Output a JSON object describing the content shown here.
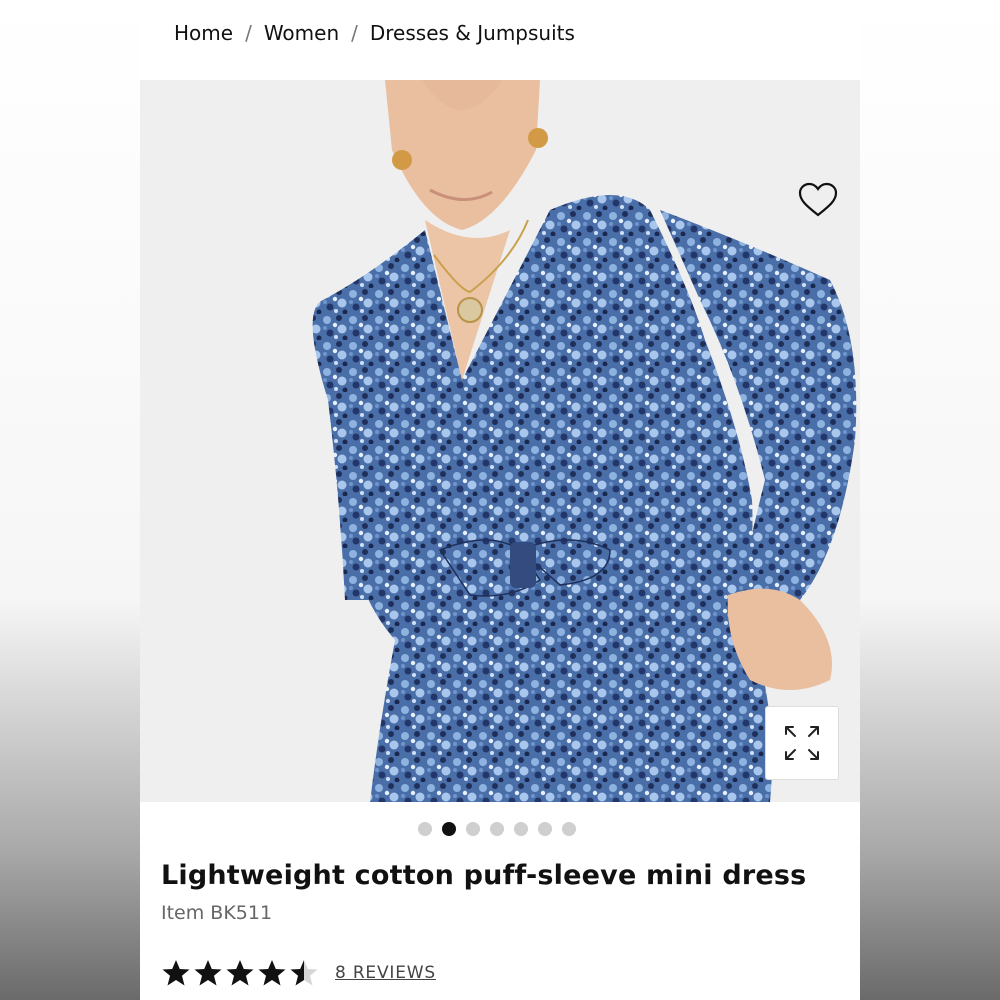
{
  "breadcrumb": {
    "items": [
      "Home",
      "Women",
      "Dresses & Jumpsuits"
    ],
    "separator": "/"
  },
  "product_image": {
    "wishlist_icon": "heart-outline-icon",
    "zoom_icon": "expand-arrows-icon",
    "dress_color": "#5b7fb5"
  },
  "carousel": {
    "total_slides": 7,
    "active_index": 1
  },
  "product": {
    "title": "Lightweight cotton puff-sleeve mini dress",
    "item_code": "Item BK511"
  },
  "rating": {
    "value": 4.5,
    "max": 5,
    "reviews_label": "8 REVIEWS"
  }
}
